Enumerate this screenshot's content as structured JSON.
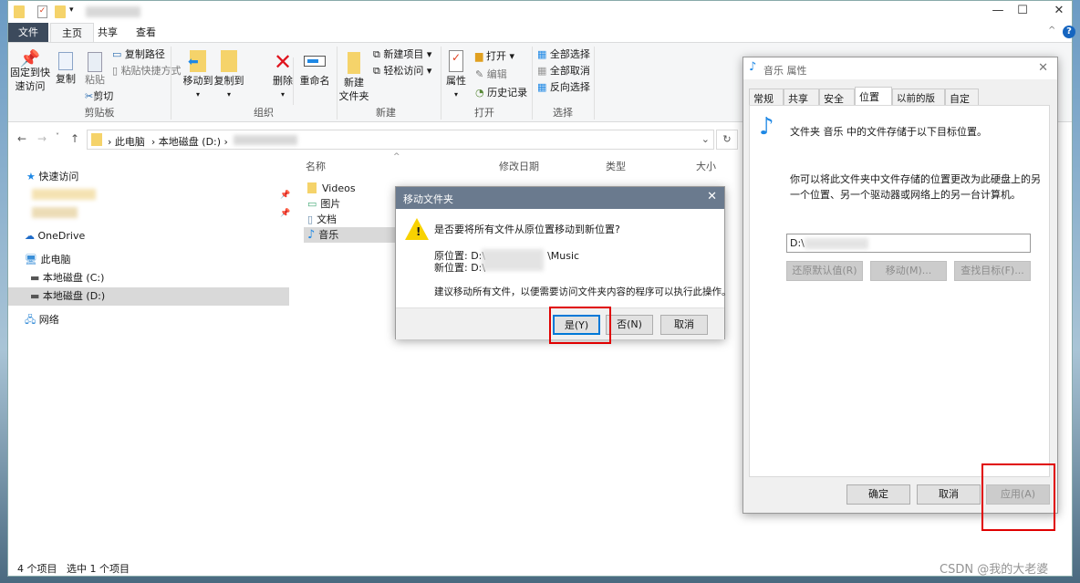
{
  "window": {
    "controls": {
      "minimize": "—",
      "maximize": "☐",
      "close": "✕"
    }
  },
  "ribbon_tabs": [
    "文件",
    "主页",
    "共享",
    "查看"
  ],
  "ribbon": {
    "clipboard": {
      "pin": "固定到快\n速访问",
      "copy": "复制",
      "paste": "粘贴",
      "copy_path": "复制路径",
      "paste_shortcut": "粘贴快捷方式",
      "cut": "剪切",
      "label": "剪贴板"
    },
    "organize": {
      "move_to": "移动到",
      "copy_to": "复制到",
      "delete": "删除",
      "rename": "重命名",
      "label": "组织"
    },
    "new": {
      "new_folder": "新建\n文件夹",
      "new_item": "新建项目",
      "easy_access": "轻松访问",
      "label": "新建"
    },
    "open": {
      "properties": "属性",
      "open": "打开",
      "edit": "编辑",
      "history": "历史记录",
      "label": "打开"
    },
    "select": {
      "select_all": "全部选择",
      "select_none": "全部取消",
      "invert": "反向选择",
      "label": "选择"
    }
  },
  "address": {
    "crumbs": [
      "此电脑",
      "本地磁盘 (D:)"
    ]
  },
  "sidebar": {
    "items": [
      "快速访问",
      "OneDrive",
      "此电脑",
      "本地磁盘 (C:)",
      "本地磁盘 (D:)",
      "网络"
    ]
  },
  "columns": [
    "名称",
    "修改日期",
    "类型",
    "大小"
  ],
  "files": [
    "Videos",
    "图片",
    "文档",
    "音乐"
  ],
  "status": {
    "count": "4 个项目",
    "selected": "选中 1 个项目"
  },
  "move_dialog": {
    "title": "移动文件夹",
    "question": "是否要将所有文件从原位置移动到新位置?",
    "old_label": "原位置: D:\\",
    "old_suffix": "\\Music",
    "new_label": "新位置: D:\\",
    "advice": "建议移动所有文件，以便需要访问文件夹内容的程序可以执行此操作。",
    "yes": "是(Y)",
    "no": "否(N)",
    "cancel": "取消"
  },
  "props_dialog": {
    "title": "音乐 属性",
    "tabs": [
      "常规",
      "共享",
      "安全",
      "位置",
      "以前的版本",
      "自定义"
    ],
    "active_tab": "位置",
    "desc1": "文件夹 音乐 中的文件存储于以下目标位置。",
    "desc2": "你可以将此文件夹中文件存储的位置更改为此硬盘上的另一个位置、另一个驱动器或网络上的另一台计算机。",
    "path": "D:\\",
    "restore": "还原默认值(R)",
    "move": "移动(M)...",
    "find": "查找目标(F)...",
    "ok": "确定",
    "cancel": "取消",
    "apply": "应用(A)"
  },
  "watermark": "CSDN @我的大老婆",
  "colors": {
    "accent": "#0078d7",
    "highlight": "#e00000",
    "selection": "#d9d9d9"
  }
}
